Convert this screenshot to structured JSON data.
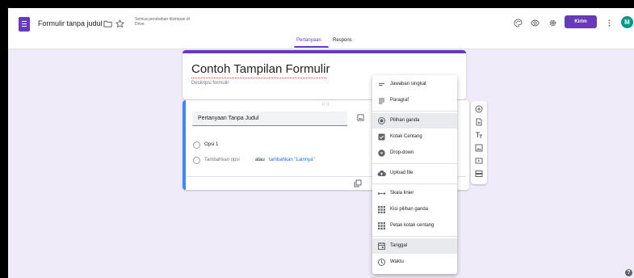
{
  "header": {
    "title": "Formulir tanpa judul",
    "save_status": "Semua perubahan disimpan di Drive",
    "send_label": "Kirim",
    "avatar_initial": "M",
    "icons": [
      "folder-icon",
      "star-icon",
      "palette-icon",
      "preview-eye-icon",
      "settings-gear-icon",
      "more-vert-icon"
    ]
  },
  "tabs": [
    {
      "label": "Pertanyaan",
      "active": true
    },
    {
      "label": "Respons",
      "active": false
    }
  ],
  "form": {
    "title": "Contoh Tampilan Formulir",
    "description_placeholder": "Deskripsi formulir"
  },
  "question": {
    "title": "Pertanyaan Tanpa Judul",
    "option_1": "Opsi 1",
    "add_option": "Tambahkan opsi",
    "add_or": "atau",
    "add_other": "tambahkan \"Lainnya\""
  },
  "type_menu": {
    "items": [
      {
        "label": "Jawaban singkat",
        "icon": "short-text-icon"
      },
      {
        "label": "Paragraf",
        "icon": "paragraph-icon"
      },
      {
        "label": "Pilihan ganda",
        "icon": "radio-icon",
        "selected": true
      },
      {
        "label": "Kotak Centang",
        "icon": "checkbox-icon"
      },
      {
        "label": "Drop-down",
        "icon": "dropdown-icon"
      },
      {
        "label": "Upload file",
        "icon": "cloud-upload-icon"
      },
      {
        "label": "Skala linier",
        "icon": "linear-scale-icon"
      },
      {
        "label": "Kisi pilihan ganda",
        "icon": "grid-icon"
      },
      {
        "label": "Petak kotak centang",
        "icon": "checkbox-grid-icon"
      },
      {
        "label": "Tanggal",
        "icon": "calendar-icon",
        "hovered": true
      },
      {
        "label": "Waktu",
        "icon": "clock-icon"
      }
    ]
  },
  "colors": {
    "accent": "#673ab7",
    "question_border": "#4285f4",
    "link": "#1a73e8",
    "avatar": "#009688"
  }
}
